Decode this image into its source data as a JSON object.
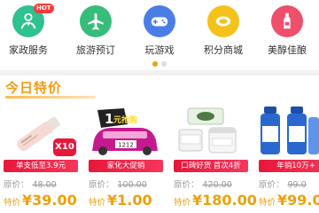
{
  "categories": [
    {
      "label": "家政服务",
      "icon": "housekeeping-person-icon",
      "color": "#2fc18e",
      "badge": "HOT"
    },
    {
      "label": "旅游预订",
      "icon": "airplane-icon",
      "color": "#37bd7a"
    },
    {
      "label": "玩游戏",
      "icon": "gamepad-icon",
      "color": "#4a7ee6"
    },
    {
      "label": "积分商城",
      "icon": "coin-icon",
      "color": "#f5c21b"
    },
    {
      "label": "美醇佳酿",
      "icon": "wine-icon",
      "color": "#ee4f6b"
    }
  ],
  "pager": {
    "active_color": "#f39c12",
    "inactive_color": "#dddddd",
    "active_index": 0,
    "count": 2
  },
  "section": {
    "title": "今日特价",
    "color": "#f39c12"
  },
  "products": [
    {
      "tag": "单支低至3.9元",
      "orig_label": "原价：",
      "orig_price": "48.00",
      "price_label": "特价",
      "price": "¥39.00",
      "badge": "X10",
      "image": "skincare-tube-icon"
    },
    {
      "tag": "家化大促销",
      "orig_label": "原价：",
      "orig_price": "100.00",
      "price_label": "特价",
      "price": "¥1.00",
      "banner_text": "1元抢购",
      "plate": "1212",
      "image": "promo-car-icon"
    },
    {
      "tag": "口碑好货 首次4折",
      "orig_label": "原价：",
      "orig_price": "420.00",
      "price_label": "特价",
      "price": "¥180.00",
      "image": "cream-jars-icon"
    },
    {
      "tag": "年销10万+",
      "orig_label": "原价：",
      "orig_price": "99.0",
      "price_label": "特价",
      "price": "¥99.0",
      "image": "detergent-bottles-icon"
    }
  ]
}
